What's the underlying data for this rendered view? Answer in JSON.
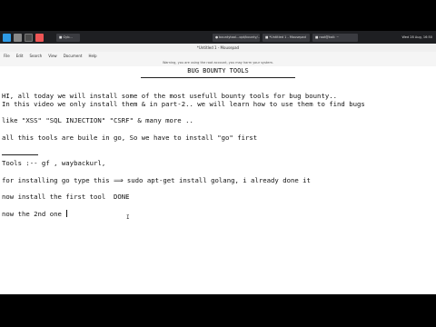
{
  "taskbar": {
    "windows": [
      "■ Gyb...",
      "● bountytool...opt/bounty/...",
      "■ *Untitled 1 - Mousepad",
      "■ root@kali: ~"
    ],
    "clock": "Wed 28 Aug, 16:50"
  },
  "window": {
    "title": "*Untitled 1 - Mousepad",
    "menus": [
      "File",
      "Edit",
      "Search",
      "View",
      "Document",
      "Help"
    ],
    "warning": "Warning, you are using the root account, you may harm your system."
  },
  "document": {
    "heading": "BUG BOUNTY TOOLS",
    "lines": [
      "HI, all today we will install some of the most usefull bounty tools for bug bounty..",
      "In this video we only install them & in part-2.. we will learn how to use them to find bugs",
      "like \"XSS\" \"SQL INJECTION\" \"CSRF\" & many more ..",
      "all this tools are buile in go, So we have to install \"go\" first",
      "Tools :-- gf , waybackurl,",
      "for installing go type this ⟹ sudo apt-get install golang, i already done it",
      "now install the first tool  DONE",
      "now the 2nd one "
    ]
  }
}
